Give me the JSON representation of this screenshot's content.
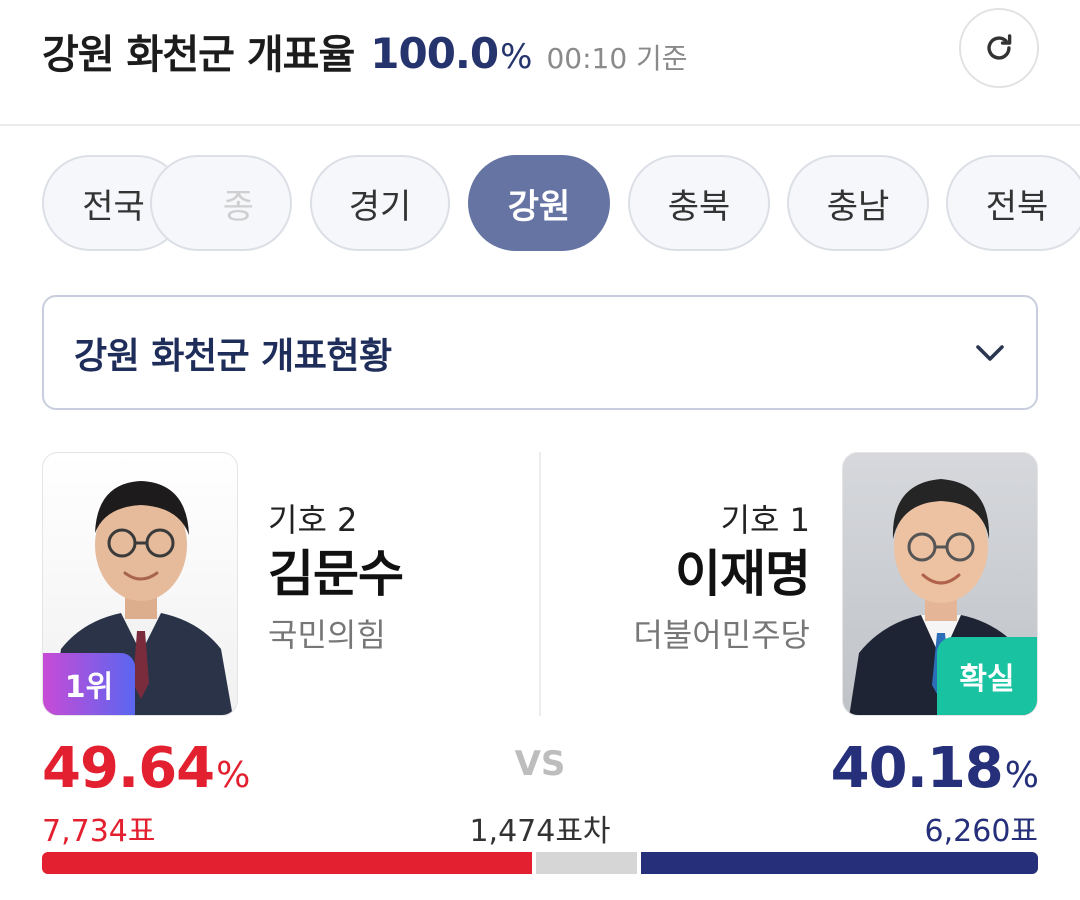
{
  "header": {
    "title": "강원 화천군 개표율",
    "rate_value": "100.0",
    "rate_unit": "%",
    "time": "00:10 기준",
    "refresh_icon": "refresh-icon"
  },
  "tabs": [
    {
      "label": "전국"
    },
    {
      "label": "종"
    },
    {
      "label": "경기"
    },
    {
      "label": "강원",
      "active": true
    },
    {
      "label": "충북"
    },
    {
      "label": "충남"
    },
    {
      "label": "전북"
    }
  ],
  "dropdown": {
    "label": "강원 화천군 개표현황",
    "icon": "chevron-down-icon"
  },
  "candidates": {
    "left": {
      "number": "기호 2",
      "name": "김문수",
      "party": "국민의힘",
      "badge": "1위",
      "percent": "49.64",
      "percent_value": 49.64,
      "votes": "7,734표",
      "votes_value": 7734,
      "color": "#e3202f"
    },
    "right": {
      "number": "기호 1",
      "name": "이재명",
      "party": "더불어민주당",
      "badge": "확실",
      "percent": "40.18",
      "percent_value": 40.18,
      "votes": "6,260표",
      "votes_value": 6260,
      "color": "#26307a"
    }
  },
  "percent_symbol": "%",
  "vs": "VS",
  "difference": "1,474표차",
  "bar": {
    "left_share": 49.64,
    "other_share": 10.18,
    "right_share": 40.18,
    "left_color": "#e3202f",
    "other_color": "#d6d6d6",
    "right_color": "#26307a"
  }
}
